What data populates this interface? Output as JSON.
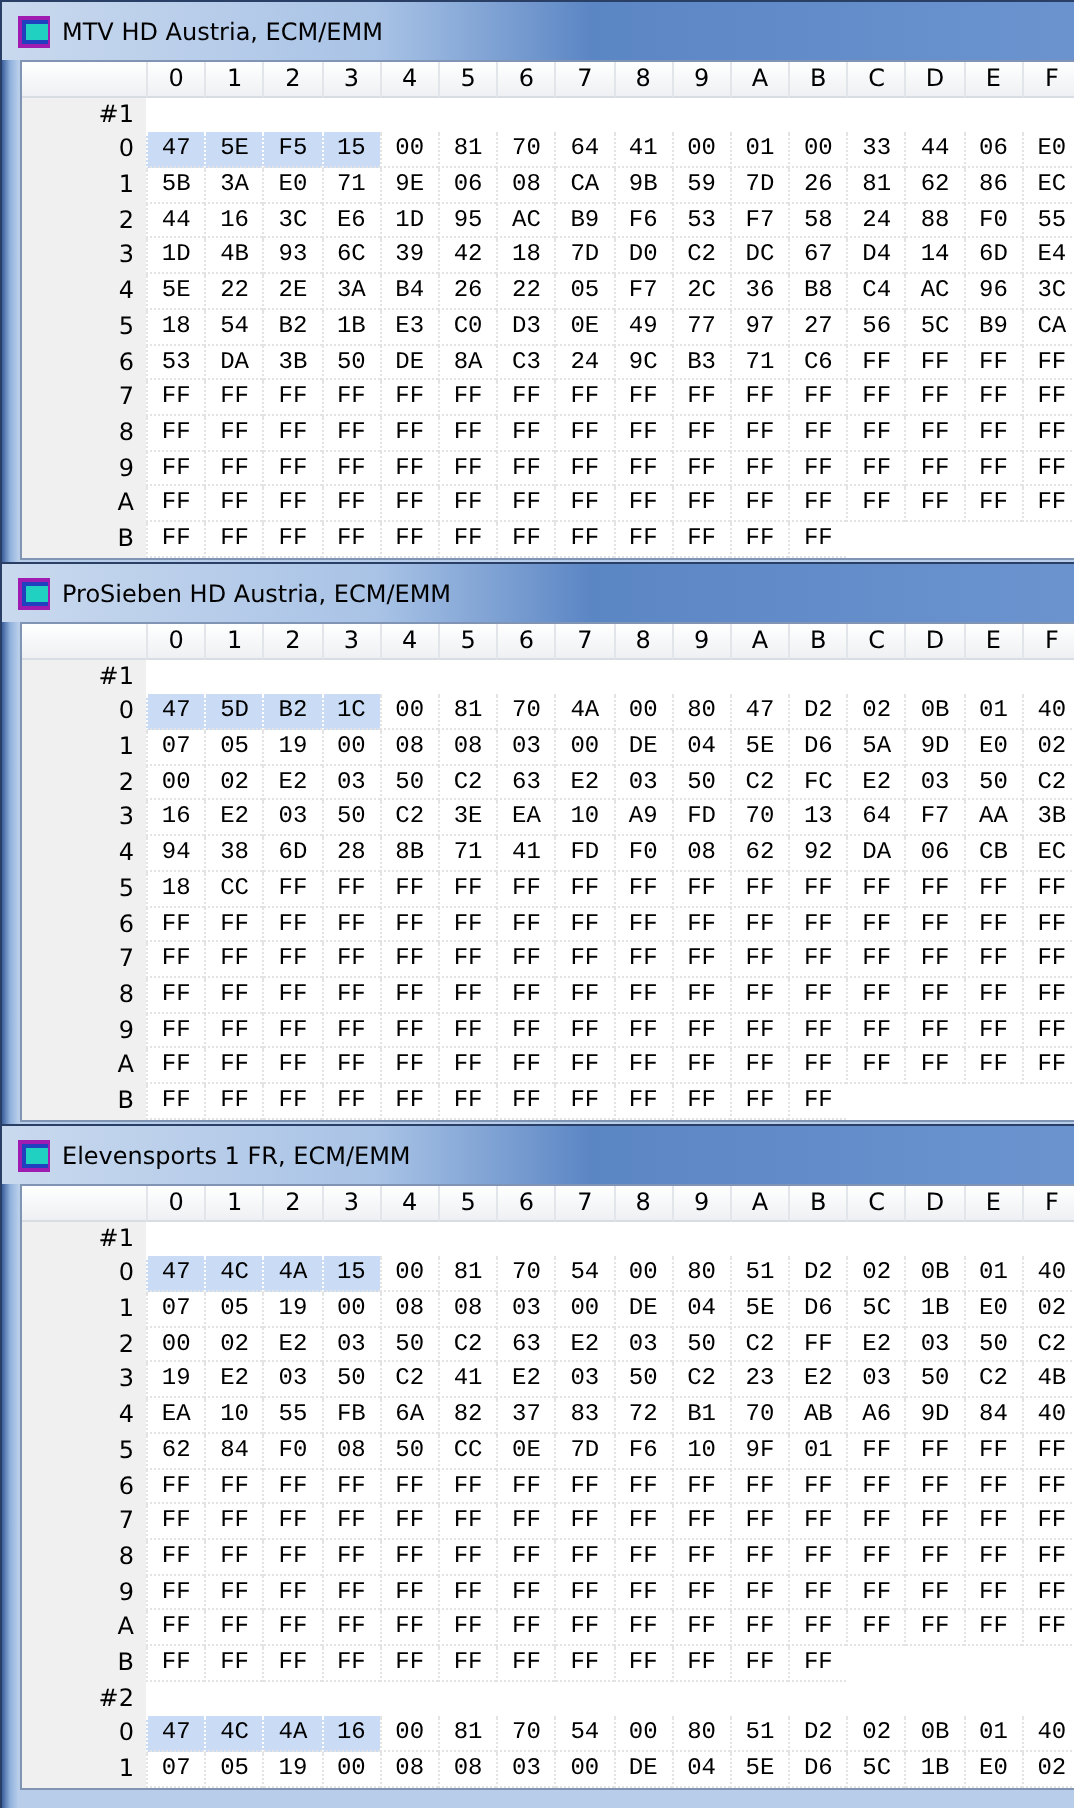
{
  "windows": [
    {
      "title": "MTV HD Austria, ECM/EMM",
      "columns": [
        "0",
        "1",
        "2",
        "3",
        "4",
        "5",
        "6",
        "7",
        "8",
        "9",
        "A",
        "B",
        "C",
        "D",
        "E",
        "F"
      ],
      "packets": [
        {
          "label": "#1",
          "rows": [
            {
              "label": "0",
              "selected": [
                true,
                true,
                true,
                true,
                false,
                false,
                false,
                false,
                false,
                false,
                false,
                false,
                false,
                false,
                false,
                false
              ],
              "cells": [
                "47",
                "5E",
                "F5",
                "15",
                "00",
                "81",
                "70",
                "64",
                "41",
                "00",
                "01",
                "00",
                "33",
                "44",
                "06",
                "E0"
              ]
            },
            {
              "label": "1",
              "cells": [
                "5B",
                "3A",
                "E0",
                "71",
                "9E",
                "06",
                "08",
                "CA",
                "9B",
                "59",
                "7D",
                "26",
                "81",
                "62",
                "86",
                "EC"
              ]
            },
            {
              "label": "2",
              "cells": [
                "44",
                "16",
                "3C",
                "E6",
                "1D",
                "95",
                "AC",
                "B9",
                "F6",
                "53",
                "F7",
                "58",
                "24",
                "88",
                "F0",
                "55"
              ]
            },
            {
              "label": "3",
              "cells": [
                "1D",
                "4B",
                "93",
                "6C",
                "39",
                "42",
                "18",
                "7D",
                "D0",
                "C2",
                "DC",
                "67",
                "D4",
                "14",
                "6D",
                "E4"
              ]
            },
            {
              "label": "4",
              "cells": [
                "5E",
                "22",
                "2E",
                "3A",
                "B4",
                "26",
                "22",
                "05",
                "F7",
                "2C",
                "36",
                "B8",
                "C4",
                "AC",
                "96",
                "3C"
              ]
            },
            {
              "label": "5",
              "cells": [
                "18",
                "54",
                "B2",
                "1B",
                "E3",
                "C0",
                "D3",
                "0E",
                "49",
                "77",
                "97",
                "27",
                "56",
                "5C",
                "B9",
                "CA"
              ]
            },
            {
              "label": "6",
              "cells": [
                "53",
                "DA",
                "3B",
                "50",
                "DE",
                "8A",
                "C3",
                "24",
                "9C",
                "B3",
                "71",
                "C6",
                "FF",
                "FF",
                "FF",
                "FF"
              ]
            },
            {
              "label": "7",
              "cells": [
                "FF",
                "FF",
                "FF",
                "FF",
                "FF",
                "FF",
                "FF",
                "FF",
                "FF",
                "FF",
                "FF",
                "FF",
                "FF",
                "FF",
                "FF",
                "FF"
              ]
            },
            {
              "label": "8",
              "cells": [
                "FF",
                "FF",
                "FF",
                "FF",
                "FF",
                "FF",
                "FF",
                "FF",
                "FF",
                "FF",
                "FF",
                "FF",
                "FF",
                "FF",
                "FF",
                "FF"
              ]
            },
            {
              "label": "9",
              "cells": [
                "FF",
                "FF",
                "FF",
                "FF",
                "FF",
                "FF",
                "FF",
                "FF",
                "FF",
                "FF",
                "FF",
                "FF",
                "FF",
                "FF",
                "FF",
                "FF"
              ]
            },
            {
              "label": "A",
              "cells": [
                "FF",
                "FF",
                "FF",
                "FF",
                "FF",
                "FF",
                "FF",
                "FF",
                "FF",
                "FF",
                "FF",
                "FF",
                "FF",
                "FF",
                "FF",
                "FF"
              ]
            },
            {
              "label": "B",
              "cells": [
                "FF",
                "FF",
                "FF",
                "FF",
                "FF",
                "FF",
                "FF",
                "FF",
                "FF",
                "FF",
                "FF",
                "FF"
              ]
            }
          ]
        }
      ]
    },
    {
      "title": "ProSieben HD Austria, ECM/EMM",
      "columns": [
        "0",
        "1",
        "2",
        "3",
        "4",
        "5",
        "6",
        "7",
        "8",
        "9",
        "A",
        "B",
        "C",
        "D",
        "E",
        "F"
      ],
      "packets": [
        {
          "label": "#1",
          "rows": [
            {
              "label": "0",
              "selected": [
                true,
                true,
                true,
                true,
                false,
                false,
                false,
                false,
                false,
                false,
                false,
                false,
                false,
                false,
                false,
                false
              ],
              "cells": [
                "47",
                "5D",
                "B2",
                "1C",
                "00",
                "81",
                "70",
                "4A",
                "00",
                "80",
                "47",
                "D2",
                "02",
                "0B",
                "01",
                "40"
              ]
            },
            {
              "label": "1",
              "cells": [
                "07",
                "05",
                "19",
                "00",
                "08",
                "08",
                "03",
                "00",
                "DE",
                "04",
                "5E",
                "D6",
                "5A",
                "9D",
                "E0",
                "02"
              ]
            },
            {
              "label": "2",
              "cells": [
                "00",
                "02",
                "E2",
                "03",
                "50",
                "C2",
                "63",
                "E2",
                "03",
                "50",
                "C2",
                "FC",
                "E2",
                "03",
                "50",
                "C2"
              ]
            },
            {
              "label": "3",
              "cells": [
                "16",
                "E2",
                "03",
                "50",
                "C2",
                "3E",
                "EA",
                "10",
                "A9",
                "FD",
                "70",
                "13",
                "64",
                "F7",
                "AA",
                "3B"
              ]
            },
            {
              "label": "4",
              "cells": [
                "94",
                "38",
                "6D",
                "28",
                "8B",
                "71",
                "41",
                "FD",
                "F0",
                "08",
                "62",
                "92",
                "DA",
                "06",
                "CB",
                "EC"
              ]
            },
            {
              "label": "5",
              "cells": [
                "18",
                "CC",
                "FF",
                "FF",
                "FF",
                "FF",
                "FF",
                "FF",
                "FF",
                "FF",
                "FF",
                "FF",
                "FF",
                "FF",
                "FF",
                "FF"
              ]
            },
            {
              "label": "6",
              "cells": [
                "FF",
                "FF",
                "FF",
                "FF",
                "FF",
                "FF",
                "FF",
                "FF",
                "FF",
                "FF",
                "FF",
                "FF",
                "FF",
                "FF",
                "FF",
                "FF"
              ]
            },
            {
              "label": "7",
              "cells": [
                "FF",
                "FF",
                "FF",
                "FF",
                "FF",
                "FF",
                "FF",
                "FF",
                "FF",
                "FF",
                "FF",
                "FF",
                "FF",
                "FF",
                "FF",
                "FF"
              ]
            },
            {
              "label": "8",
              "cells": [
                "FF",
                "FF",
                "FF",
                "FF",
                "FF",
                "FF",
                "FF",
                "FF",
                "FF",
                "FF",
                "FF",
                "FF",
                "FF",
                "FF",
                "FF",
                "FF"
              ]
            },
            {
              "label": "9",
              "cells": [
                "FF",
                "FF",
                "FF",
                "FF",
                "FF",
                "FF",
                "FF",
                "FF",
                "FF",
                "FF",
                "FF",
                "FF",
                "FF",
                "FF",
                "FF",
                "FF"
              ]
            },
            {
              "label": "A",
              "cells": [
                "FF",
                "FF",
                "FF",
                "FF",
                "FF",
                "FF",
                "FF",
                "FF",
                "FF",
                "FF",
                "FF",
                "FF",
                "FF",
                "FF",
                "FF",
                "FF"
              ]
            },
            {
              "label": "B",
              "cells": [
                "FF",
                "FF",
                "FF",
                "FF",
                "FF",
                "FF",
                "FF",
                "FF",
                "FF",
                "FF",
                "FF",
                "FF"
              ]
            }
          ]
        }
      ]
    },
    {
      "title": "Elevensports 1 FR, ECM/EMM",
      "columns": [
        "0",
        "1",
        "2",
        "3",
        "4",
        "5",
        "6",
        "7",
        "8",
        "9",
        "A",
        "B",
        "C",
        "D",
        "E",
        "F"
      ],
      "packets": [
        {
          "label": "#1",
          "rows": [
            {
              "label": "0",
              "selected": [
                true,
                true,
                true,
                true,
                false,
                false,
                false,
                false,
                false,
                false,
                false,
                false,
                false,
                false,
                false,
                false
              ],
              "cells": [
                "47",
                "4C",
                "4A",
                "15",
                "00",
                "81",
                "70",
                "54",
                "00",
                "80",
                "51",
                "D2",
                "02",
                "0B",
                "01",
                "40"
              ]
            },
            {
              "label": "1",
              "cells": [
                "07",
                "05",
                "19",
                "00",
                "08",
                "08",
                "03",
                "00",
                "DE",
                "04",
                "5E",
                "D6",
                "5C",
                "1B",
                "E0",
                "02"
              ]
            },
            {
              "label": "2",
              "cells": [
                "00",
                "02",
                "E2",
                "03",
                "50",
                "C2",
                "63",
                "E2",
                "03",
                "50",
                "C2",
                "FF",
                "E2",
                "03",
                "50",
                "C2"
              ]
            },
            {
              "label": "3",
              "cells": [
                "19",
                "E2",
                "03",
                "50",
                "C2",
                "41",
                "E2",
                "03",
                "50",
                "C2",
                "23",
                "E2",
                "03",
                "50",
                "C2",
                "4B"
              ]
            },
            {
              "label": "4",
              "cells": [
                "EA",
                "10",
                "55",
                "FB",
                "6A",
                "82",
                "37",
                "83",
                "72",
                "B1",
                "70",
                "AB",
                "A6",
                "9D",
                "84",
                "40"
              ]
            },
            {
              "label": "5",
              "cells": [
                "62",
                "84",
                "F0",
                "08",
                "50",
                "CC",
                "0E",
                "7D",
                "F6",
                "10",
                "9F",
                "01",
                "FF",
                "FF",
                "FF",
                "FF"
              ]
            },
            {
              "label": "6",
              "cells": [
                "FF",
                "FF",
                "FF",
                "FF",
                "FF",
                "FF",
                "FF",
                "FF",
                "FF",
                "FF",
                "FF",
                "FF",
                "FF",
                "FF",
                "FF",
                "FF"
              ]
            },
            {
              "label": "7",
              "cells": [
                "FF",
                "FF",
                "FF",
                "FF",
                "FF",
                "FF",
                "FF",
                "FF",
                "FF",
                "FF",
                "FF",
                "FF",
                "FF",
                "FF",
                "FF",
                "FF"
              ]
            },
            {
              "label": "8",
              "cells": [
                "FF",
                "FF",
                "FF",
                "FF",
                "FF",
                "FF",
                "FF",
                "FF",
                "FF",
                "FF",
                "FF",
                "FF",
                "FF",
                "FF",
                "FF",
                "FF"
              ]
            },
            {
              "label": "9",
              "cells": [
                "FF",
                "FF",
                "FF",
                "FF",
                "FF",
                "FF",
                "FF",
                "FF",
                "FF",
                "FF",
                "FF",
                "FF",
                "FF",
                "FF",
                "FF",
                "FF"
              ]
            },
            {
              "label": "A",
              "cells": [
                "FF",
                "FF",
                "FF",
                "FF",
                "FF",
                "FF",
                "FF",
                "FF",
                "FF",
                "FF",
                "FF",
                "FF",
                "FF",
                "FF",
                "FF",
                "FF"
              ]
            },
            {
              "label": "B",
              "cells": [
                "FF",
                "FF",
                "FF",
                "FF",
                "FF",
                "FF",
                "FF",
                "FF",
                "FF",
                "FF",
                "FF",
                "FF"
              ]
            }
          ]
        },
        {
          "label": "#2",
          "rows": [
            {
              "label": "0",
              "selected": [
                true,
                true,
                true,
                true,
                false,
                false,
                false,
                false,
                false,
                false,
                false,
                false,
                false,
                false,
                false,
                false
              ],
              "cells": [
                "47",
                "4C",
                "4A",
                "16",
                "00",
                "81",
                "70",
                "54",
                "00",
                "80",
                "51",
                "D2",
                "02",
                "0B",
                "01",
                "40"
              ]
            },
            {
              "label": "1",
              "cells": [
                "07",
                "05",
                "19",
                "00",
                "08",
                "08",
                "03",
                "00",
                "DE",
                "04",
                "5E",
                "D6",
                "5C",
                "1B",
                "E0",
                "02"
              ]
            }
          ]
        }
      ]
    }
  ]
}
